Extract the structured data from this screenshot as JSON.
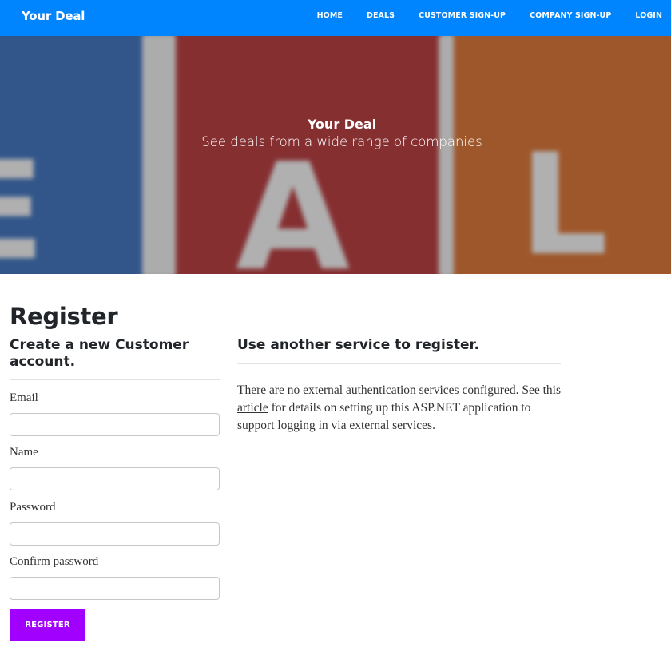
{
  "navbar": {
    "brand": "Your Deal",
    "links": [
      "HOME",
      "DEALS",
      "CUSTOMER SIGN-UP",
      "COMPANY SIGN-UP",
      "LOGIN"
    ],
    "background_color": "#0085ff"
  },
  "hero": {
    "title": "Your Deal",
    "subtitle": "See deals from a wide range of companies"
  },
  "page": {
    "title": "Register"
  },
  "form": {
    "heading": "Create a new Customer account.",
    "fields": [
      {
        "label": "Email",
        "value": ""
      },
      {
        "label": "Name",
        "value": ""
      },
      {
        "label": "Password",
        "value": ""
      },
      {
        "label": "Confirm password",
        "value": ""
      }
    ],
    "submit_label": "REGISTER",
    "submit_color": "#a100ff"
  },
  "external": {
    "heading": "Use another service to register.",
    "text_before": "There are no external authentication services configured. See ",
    "link_text": "this article",
    "text_after": " for details on setting up this ASP.NET application to support logging in via external services."
  }
}
